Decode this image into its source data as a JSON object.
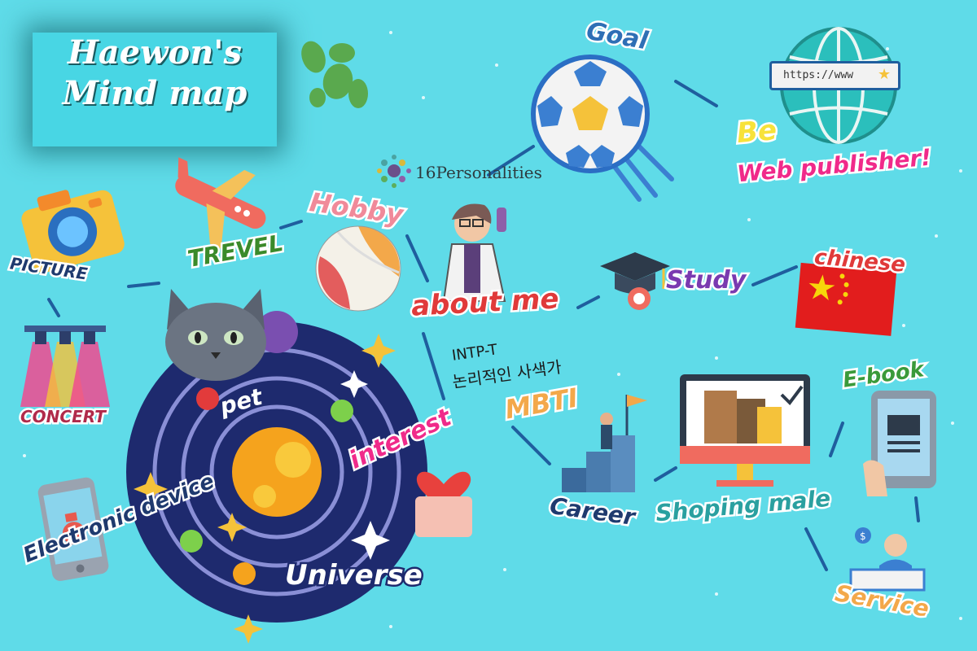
{
  "title": {
    "line1": "Haewon's",
    "line2": "Mind map"
  },
  "nodes": {
    "center": "about me",
    "goal": "Goal",
    "be": "Be",
    "web_publisher": "Web publisher!",
    "url": "https://www",
    "personalities_logo": "16Personalities",
    "hobby": "Hobby",
    "travel": "TREVEL",
    "picture": "PICTURE",
    "concert": "CONCERT",
    "pet": "pet",
    "interest": "interest",
    "electronic_device": "Electronic device",
    "universe": "Universe",
    "mbti": "MBTI",
    "mbti_type": "INTP-T",
    "mbti_desc": "논리적인 사색가",
    "study": "Study",
    "chinese": "chinese",
    "career": "Career",
    "shopping_mall": "Shoping male",
    "ebook": "E-book",
    "service": "Service"
  },
  "colors": {
    "background": "#5fdbe8",
    "connector": "#1f5e9e",
    "accent_yellow": "#f7e23a",
    "accent_pink": "#f02a8a"
  },
  "icons": [
    "leaf-icon",
    "soccer-ball-icon",
    "globe-icon",
    "airplane-icon",
    "camera-icon",
    "beach-ball-icon",
    "scientist-icon",
    "graduation-cap-icon",
    "china-flag-icon",
    "spotlight-icon",
    "cat-icon",
    "solar-system-icon",
    "phone-icon",
    "heart-gift-icon",
    "career-flag-icon",
    "shopping-monitor-icon",
    "tablet-ebook-icon",
    "service-desk-icon"
  ]
}
